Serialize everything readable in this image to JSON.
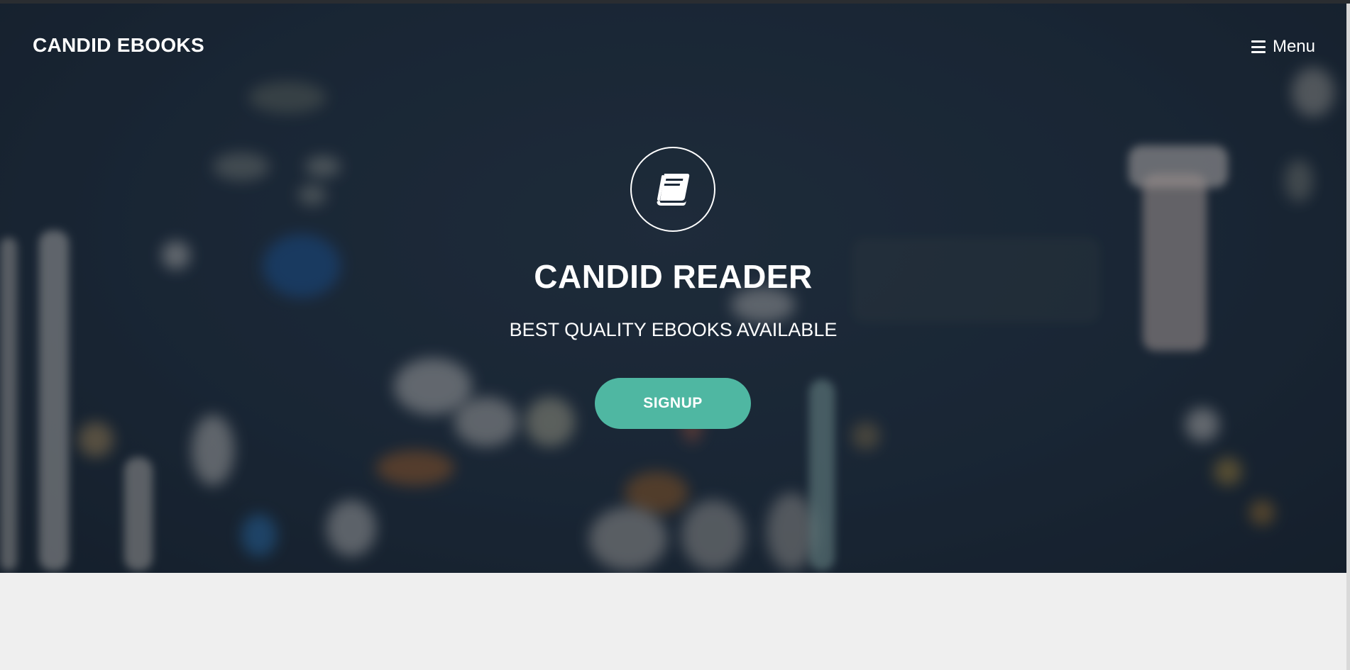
{
  "navbar": {
    "brand": "CANDID EBOOKS",
    "menu_label": "Menu",
    "menu_icon": "hamburger-icon"
  },
  "hero": {
    "logo_icon": "book-icon",
    "title": "CANDID READER",
    "subtitle": "BEST QUALITY EBOOKS AVAILABLE",
    "signup_label": "SIGNUP"
  },
  "colors": {
    "accent": "#4fb7a2",
    "hero_background": "#1b2837",
    "page_background": "#efefef",
    "text": "#ffffff"
  }
}
